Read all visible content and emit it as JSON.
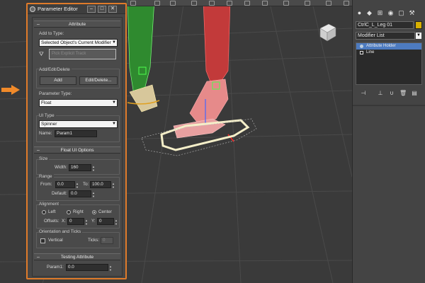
{
  "window": {
    "title": "Parameter Editor"
  },
  "attribute_rollout": {
    "header": "Attribute",
    "add_to_type_label": "Add to Type:",
    "add_to_type_value": "Selected Object's Current Modifier",
    "pick_explicit_track": "Pick Explicit Track"
  },
  "add_edit_delete": {
    "label": "Add/Edit/Delete",
    "add_button": "Add",
    "edit_delete_button": "Edit/Delete..."
  },
  "parameter_type": {
    "label": "Parameter Type:",
    "value": "Float"
  },
  "ui_type": {
    "label": "UI Type",
    "value": "Spinner",
    "name_label": "Name:",
    "name_value": "Param1"
  },
  "float_ui_options": {
    "header": "Float UI Options",
    "size_label": "Size",
    "width_label": "Width:",
    "width_value": "160",
    "range_label": "Range",
    "from_label": "From:",
    "from_value": "0.0",
    "to_label": "To:",
    "to_value": "100.0",
    "default_label": "Default:",
    "default_value": "0.0",
    "alignment_label": "Alignment",
    "left_label": "Left",
    "right_label": "Right",
    "center_label": "Center",
    "selected_alignment": "Center",
    "offsets_label": "Offsets:",
    "x_label": "X:",
    "x_value": "0",
    "y_label": "Y:",
    "y_value": "0",
    "orientation_label": "Orientation and Ticks",
    "vertical_label": "Vertical",
    "ticks_label": "Ticks:",
    "ticks_value": "0"
  },
  "testing_attribute": {
    "header": "Testing Attribute",
    "param_label": "Param1:",
    "param_value": "0.0"
  },
  "command_panel": {
    "object_name": "CtrlC_L_Leg 01",
    "object_color": "#d8b000",
    "modifier_list": "Modifier List",
    "stack_items": [
      {
        "label": "Attribute Holder"
      },
      {
        "label": "Line"
      }
    ],
    "tabs": [
      "create-icon",
      "modify-icon",
      "hierarchy-icon",
      "motion-icon",
      "display-icon",
      "utilities-icon"
    ]
  },
  "colors": {
    "accent_border": "#e07b2a",
    "selected_stack": "#4d7bc0"
  }
}
